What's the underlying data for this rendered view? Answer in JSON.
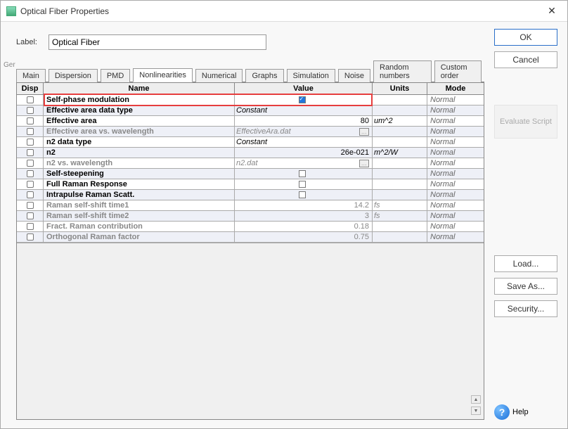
{
  "window": {
    "title": "Optical Fiber Properties"
  },
  "label": {
    "caption": "Label:",
    "value": "Optical Fiber"
  },
  "tabs": [
    "Main",
    "Dispersion",
    "PMD",
    "Nonlinearities",
    "Numerical",
    "Graphs",
    "Simulation",
    "Noise",
    "Random numbers",
    "Custom order"
  ],
  "active_tab": "Nonlinearities",
  "columns": {
    "disp": "Disp",
    "name": "Name",
    "value": "Value",
    "units": "Units",
    "mode": "Mode"
  },
  "rows": [
    {
      "name": "Self-phase modulation",
      "vtype": "check",
      "checked": true,
      "units": "",
      "mode": "Normal"
    },
    {
      "name": "Effective area data type",
      "vtype": "text",
      "value": "Constant",
      "align": "left",
      "units": "",
      "mode": "Normal"
    },
    {
      "name": "Effective area",
      "vtype": "num",
      "value": "80",
      "units": "um^2",
      "mode": "Normal"
    },
    {
      "name": "Effective area vs. wavelength",
      "vtype": "browse",
      "value": "EffectiveAra.dat",
      "units": "",
      "mode": "Normal",
      "faded": true
    },
    {
      "name": "n2 data type",
      "vtype": "text",
      "value": "Constant",
      "align": "left",
      "units": "",
      "mode": "Normal"
    },
    {
      "name": "n2",
      "vtype": "num",
      "value": "26e-021",
      "units": "m^2/W",
      "mode": "Normal"
    },
    {
      "name": "n2 vs. wavelength",
      "vtype": "browse",
      "value": "n2.dat",
      "units": "",
      "mode": "Normal",
      "faded": true
    },
    {
      "name": "Self-steepening",
      "vtype": "check",
      "checked": false,
      "units": "",
      "mode": "Normal"
    },
    {
      "name": "Full Raman Response",
      "vtype": "check",
      "checked": false,
      "units": "",
      "mode": "Normal"
    },
    {
      "name": "Intrapulse Raman Scatt.",
      "vtype": "check",
      "checked": false,
      "units": "",
      "mode": "Normal"
    },
    {
      "name": "Raman self-shift time1",
      "vtype": "num",
      "value": "14.2",
      "units": "fs",
      "mode": "Normal",
      "faded": true
    },
    {
      "name": "Raman self-shift time2",
      "vtype": "num",
      "value": "3",
      "units": "fs",
      "mode": "Normal",
      "faded": true
    },
    {
      "name": "Fract. Raman contribution",
      "vtype": "num",
      "value": "0.18",
      "units": "",
      "mode": "Normal",
      "faded": true
    },
    {
      "name": "Orthogonal Raman factor",
      "vtype": "num",
      "value": "0.75",
      "units": "",
      "mode": "Normal",
      "faded": true
    }
  ],
  "buttons": {
    "ok": "OK",
    "cancel": "Cancel",
    "evaluate": "Evaluate Script",
    "load": "Load...",
    "saveas": "Save As...",
    "security": "Security...",
    "help": "Help"
  },
  "sliver": "Ger"
}
